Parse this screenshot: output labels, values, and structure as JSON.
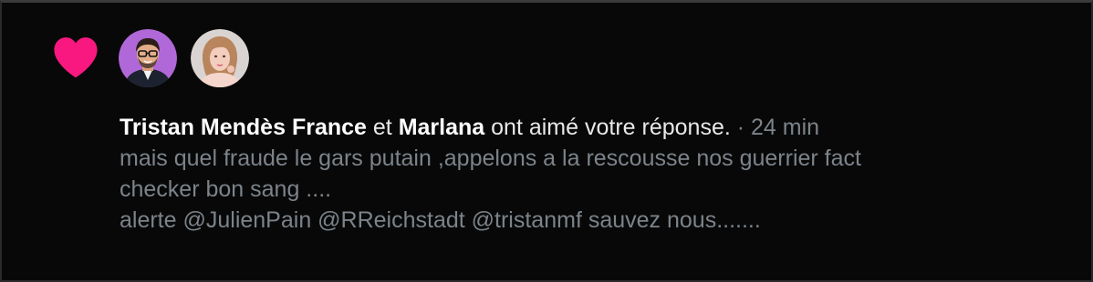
{
  "notification": {
    "type_icon": "heart-icon",
    "heart_color": "#f91880",
    "avatars": [
      {
        "name": "Tristan Mendès France",
        "icon": "avatar-man-glasses"
      },
      {
        "name": "Marlana",
        "icon": "avatar-woman"
      }
    ],
    "user1": "Tristan Mendès France",
    "connector": "et",
    "user2": "Marlana",
    "action": "ont aimé votre réponse.",
    "separator": "·",
    "timestamp": "24 min",
    "reply_lines": [
      "mais quel fraude le gars putain ,appelons a la rescousse nos guerrier fact",
      "checker bon sang ....",
      "alerte @JulienPain @RReichstadt @tristanmf sauvez nous......."
    ]
  }
}
